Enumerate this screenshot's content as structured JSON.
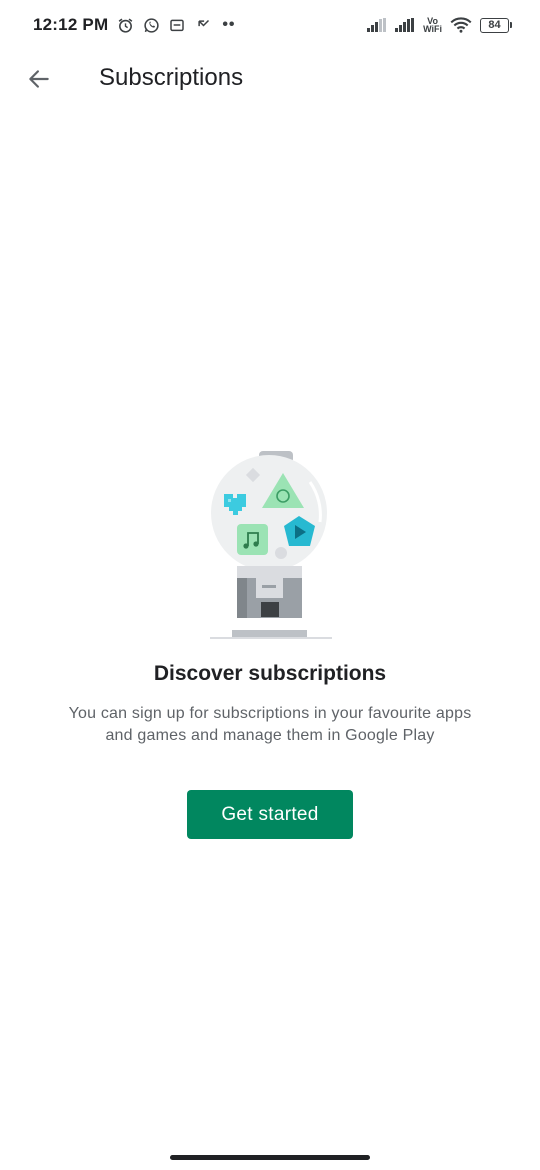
{
  "status_bar": {
    "time": "12:12 PM",
    "icons_left": [
      "alarm-icon",
      "whatsapp-icon",
      "message-icon",
      "missed-call-icon"
    ],
    "dots": "••",
    "vo_label": "Vo",
    "wifi_label": "WiFi",
    "battery": "84"
  },
  "app_bar": {
    "title": "Subscriptions",
    "back_icon": "arrow-back-icon"
  },
  "empty_state": {
    "heading": "Discover subscriptions",
    "description": "You can sign up for subscriptions in your favourite apps and games and manage them in Google Play",
    "button_label": "Get started",
    "illustration": "gumball-machine-illustration"
  },
  "colors": {
    "accent": "#01875f",
    "title_text": "#202124",
    "secondary_text": "#5f6368"
  }
}
